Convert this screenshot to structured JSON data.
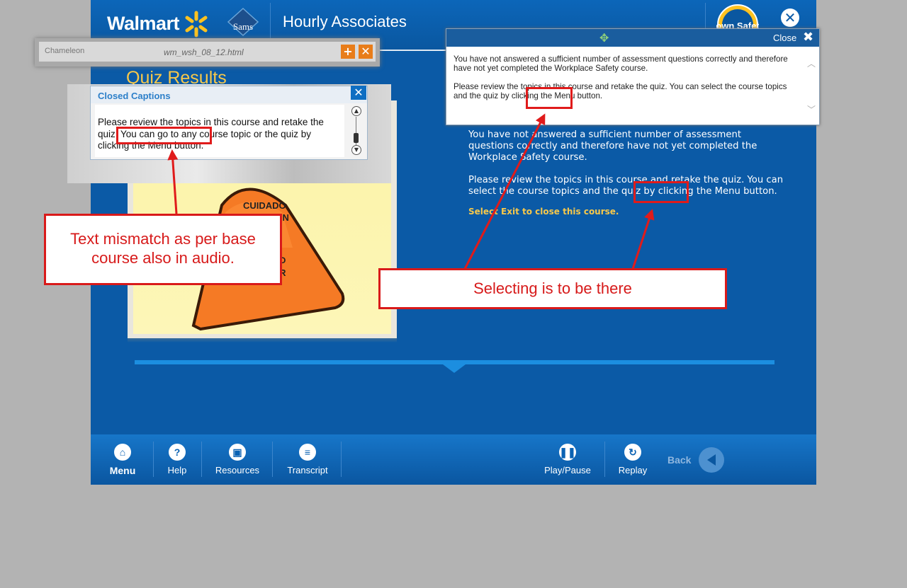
{
  "header": {
    "brand": "Walmart",
    "sams": "Sams",
    "title": "Hourly Associates",
    "badge": "I own Safety"
  },
  "main": {
    "quiz_title": "Quiz Results",
    "result_p1": "You have not answered a sufficient number of assessment questions correctly and therefore have not yet completed the Workplace Safety course.",
    "result_p2": "Please review the topics in this course and retake the quiz.  You can select the course topics and the quiz by clicking the Menu button.",
    "exit_note": "Select Exit to close this course.",
    "cone_text": [
      "CUIDADO",
      "AUTION",
      "DADO",
      "OR"
    ]
  },
  "captions": {
    "title": "Closed Captions",
    "text": "Please review the topics in this course and retake the quiz.  You can go to any course topic or the quiz by clicking the Menu button."
  },
  "chameleon": {
    "logo": "Chameleon",
    "file": "wm_wsh_08_12.html"
  },
  "popup": {
    "close_label": "Close",
    "p1": "You have not answered a sufficient number of assessment questions correctly and therefore have not yet completed the Workplace Safety course.",
    "p2": "Please review the topics in this course and retake the quiz.  You can select the course topics and the quiz by clicking the Menu button."
  },
  "footer": {
    "menu": "Menu",
    "help": "Help",
    "resources": "Resources",
    "transcript": "Transcript",
    "play_pause": "Play/Pause",
    "replay": "Replay",
    "back": "Back"
  },
  "annotations": {
    "left": "Text mismatch as per base course also in audio.",
    "right": "Selecting is to be there"
  },
  "colors": {
    "course_blue": "#0b5aa6",
    "accent_yellow": "#f7c84a",
    "annotation_red": "#d91a1a"
  }
}
